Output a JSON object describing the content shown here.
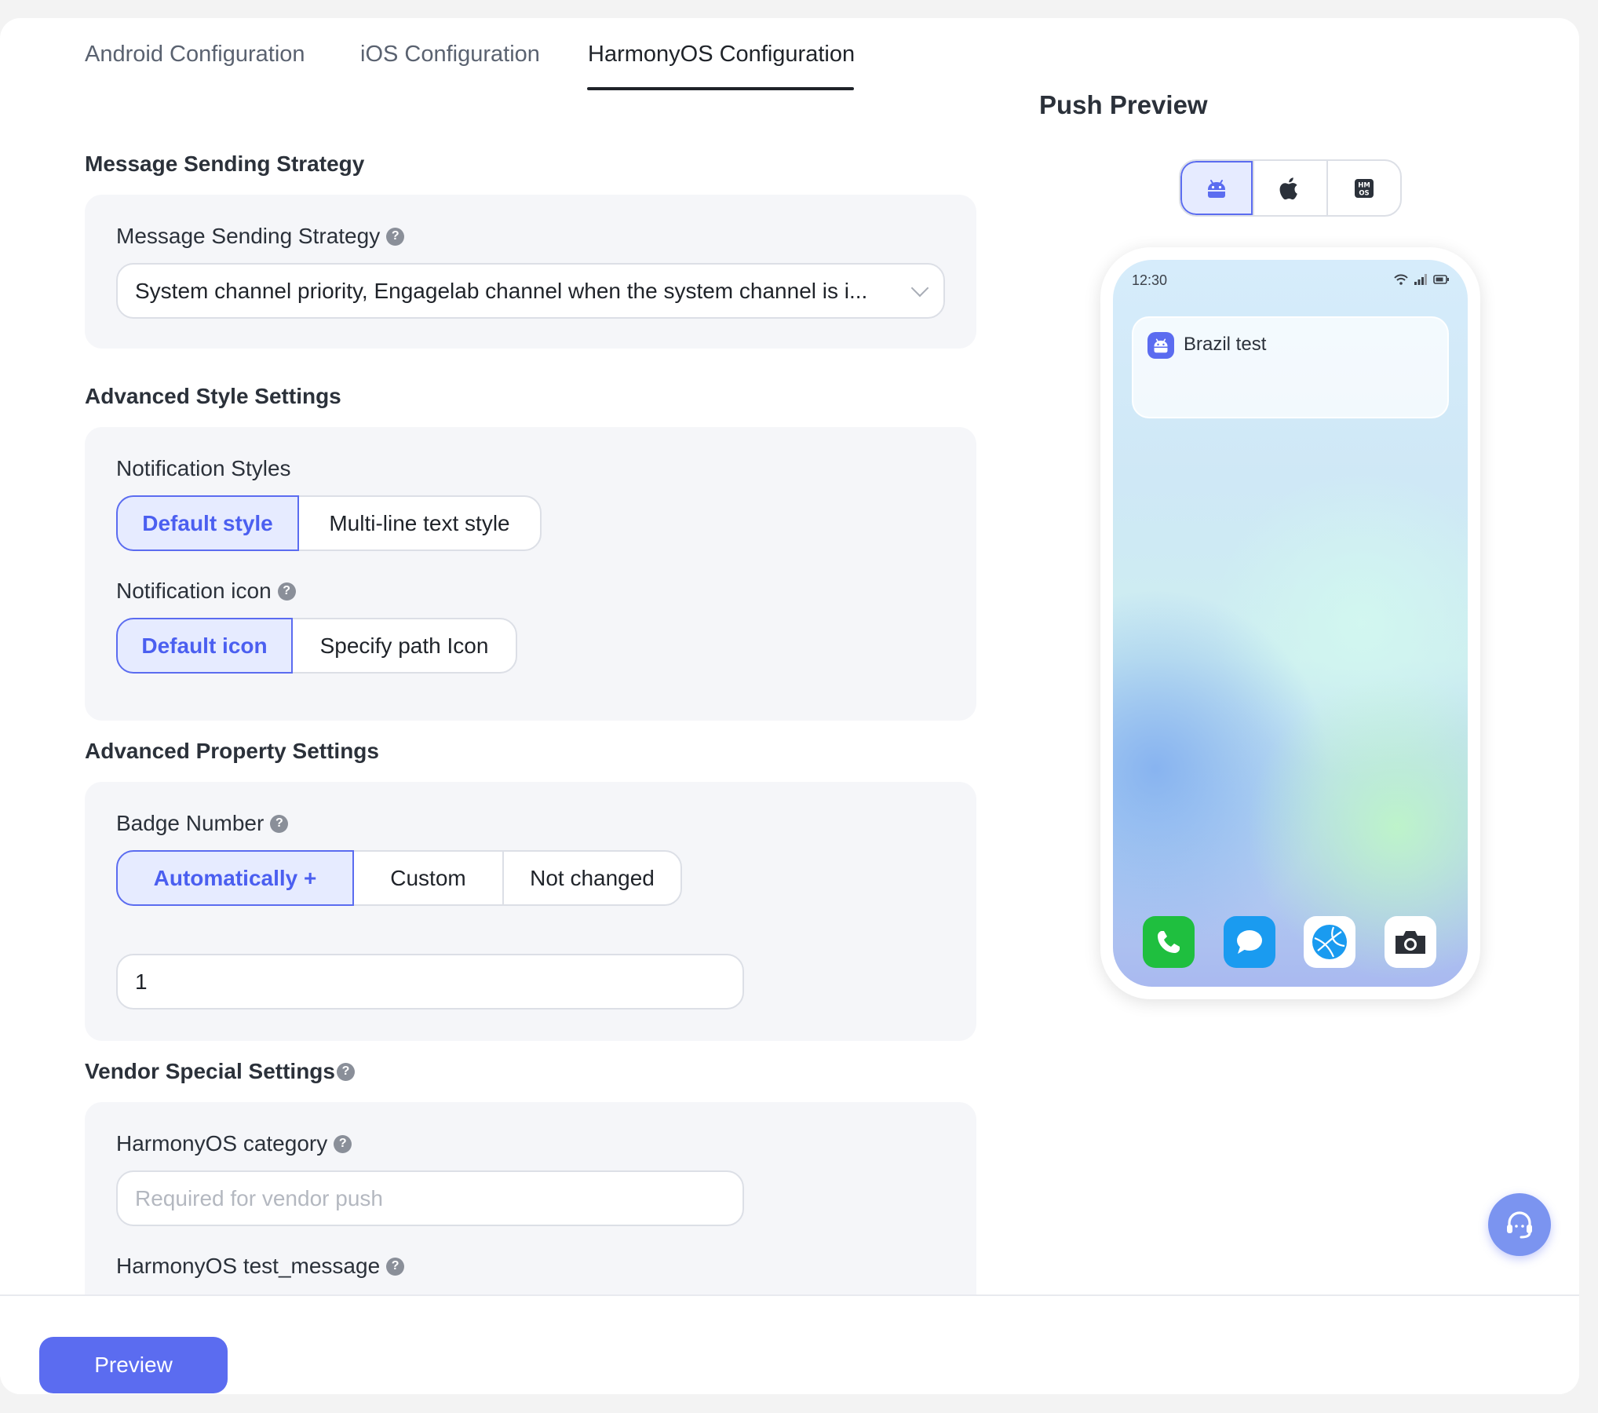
{
  "tabs": [
    {
      "label": "Android Configuration"
    },
    {
      "label": "iOS Configuration"
    },
    {
      "label": "HarmonyOS Configuration",
      "active": true
    }
  ],
  "sections": {
    "strategy": {
      "title": "Message Sending Strategy",
      "field_label": "Message Sending Strategy",
      "select_value": "System channel priority, Engagelab channel when the system channel is i..."
    },
    "style": {
      "title": "Advanced Style Settings",
      "notification_styles_label": "Notification Styles",
      "notification_styles_options": [
        "Default style",
        "Multi-line text style"
      ],
      "notification_styles_selected": "Default style",
      "notification_icon_label": "Notification icon",
      "notification_icon_options": [
        "Default icon",
        "Specify path Icon"
      ],
      "notification_icon_selected": "Default icon"
    },
    "property": {
      "title": "Advanced Property Settings",
      "badge_label": "Badge Number",
      "badge_options": [
        "Automatically +",
        "Custom",
        "Not changed"
      ],
      "badge_selected": "Automatically +",
      "badge_value": "1"
    },
    "vendor": {
      "title": "Vendor Special Settings",
      "category_label": "HarmonyOS category",
      "category_placeholder": "Required for vendor push",
      "test_message_label": "HarmonyOS test_message"
    }
  },
  "preview": {
    "title": "Push Preview",
    "os_options": [
      "android-icon",
      "apple-icon",
      "hmos-icon"
    ],
    "os_selected": "android-icon",
    "phone": {
      "time": "12:30",
      "notification_title": "Brazil test",
      "dock_apps": [
        "phone-app-icon",
        "messages-app-icon",
        "browser-app-icon",
        "camera-app-icon"
      ]
    }
  },
  "footer": {
    "preview_button": "Preview"
  },
  "colors": {
    "accent": "#5b6cf0",
    "selected_bg": "#e6ebff",
    "panel_bg": "#f5f6f9"
  }
}
